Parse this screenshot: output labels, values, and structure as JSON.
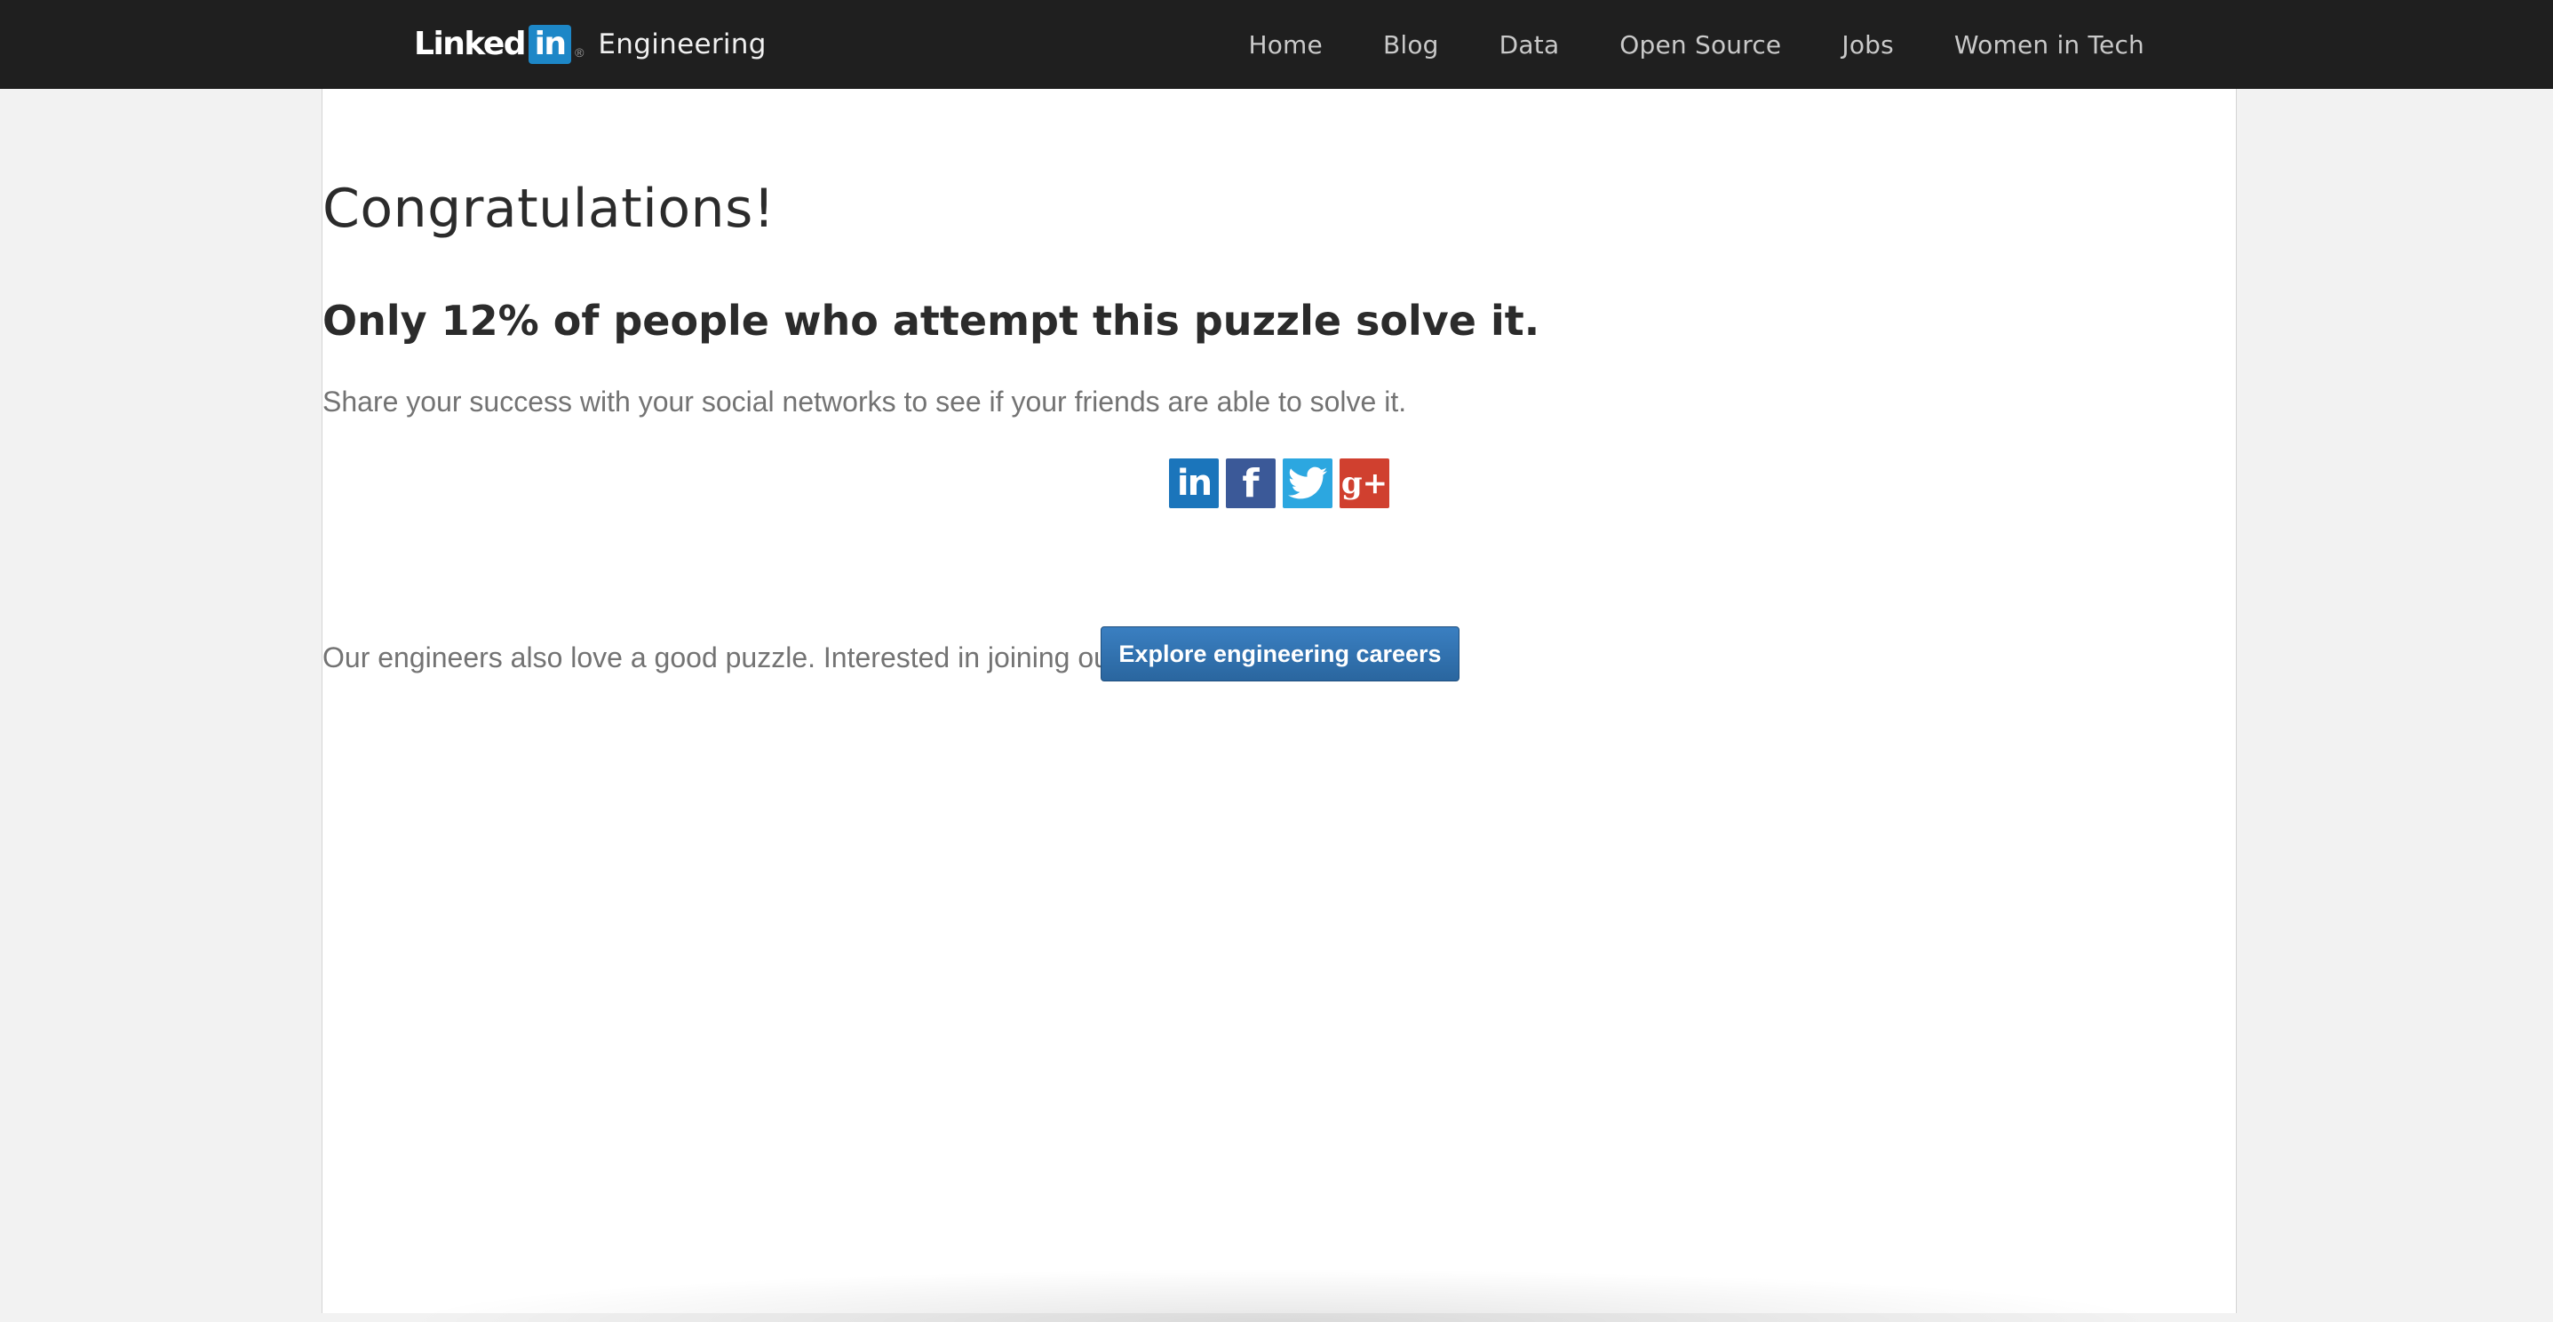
{
  "header": {
    "logo_word": "Linked",
    "logo_in": "in",
    "logo_reg": "®",
    "subtitle": "Engineering",
    "nav": [
      {
        "label": "Home"
      },
      {
        "label": "Blog"
      },
      {
        "label": "Data"
      },
      {
        "label": "Open Source"
      },
      {
        "label": "Jobs"
      },
      {
        "label": "Women in Tech"
      }
    ]
  },
  "main": {
    "title": "Congratulations!",
    "subtitle": "Only 12% of people who attempt this puzzle solve it.",
    "share_text": "Share your success with your social networks to see if your friends are able to solve it.",
    "social": {
      "linkedin_glyph": "in",
      "facebook_glyph": "f",
      "gplus_glyph": "g+"
    },
    "careers_text": "Our engineers also love a good puzzle. Interested in joining our team?",
    "cta_label": "Explore engineering careers"
  },
  "colors": {
    "topbar": "#1f1f1f",
    "linkedin_blue": "#1b75bb",
    "facebook_blue": "#3b5998",
    "twitter_blue": "#2ca7e0",
    "gplus_red": "#d0402f",
    "cta_blue": "#2f71b0"
  },
  "icons": [
    "linkedin-icon",
    "facebook-icon",
    "twitter-icon",
    "google-plus-icon"
  ]
}
